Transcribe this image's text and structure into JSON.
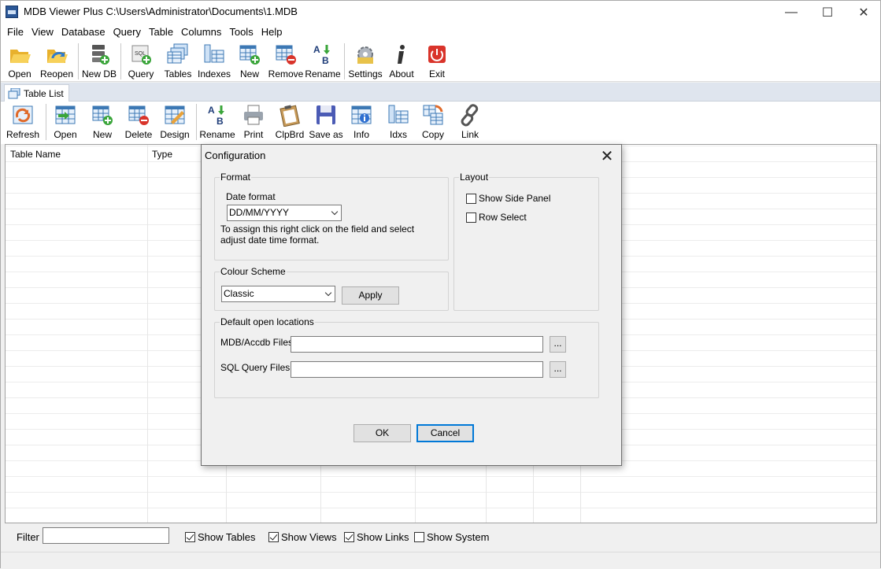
{
  "window": {
    "title": "MDB Viewer Plus C:\\Users\\Administrator\\Documents\\1.MDB",
    "minimize": "—",
    "maximize": "☐",
    "close": "✕"
  },
  "menu": [
    "File",
    "View",
    "Database",
    "Query",
    "Table",
    "Columns",
    "Tools",
    "Help"
  ],
  "toolbar_main": [
    {
      "label": "Open",
      "icon": "folder-open-icon"
    },
    {
      "label": "Reopen",
      "icon": "folder-reopen-icon"
    },
    {
      "label": "New DB",
      "icon": "new-database-icon"
    },
    {
      "label": "Query",
      "icon": "sql-query-icon"
    },
    {
      "label": "Tables",
      "icon": "tables-icon"
    },
    {
      "label": "Indexes",
      "icon": "indexes-icon"
    },
    {
      "label": "New",
      "icon": "new-table-icon"
    },
    {
      "label": "Remove",
      "icon": "remove-table-icon"
    },
    {
      "label": "Rename",
      "icon": "rename-icon"
    },
    {
      "label": "Settings",
      "icon": "settings-icon"
    },
    {
      "label": "About",
      "icon": "info-icon"
    },
    {
      "label": "Exit",
      "icon": "power-icon"
    }
  ],
  "tab": {
    "label": "Table List"
  },
  "toolbar_table": [
    {
      "label": "Refresh",
      "icon": "refresh-icon"
    },
    {
      "label": "Open",
      "icon": "open-table-icon"
    },
    {
      "label": "New",
      "icon": "new-table-icon"
    },
    {
      "label": "Delete",
      "icon": "delete-table-icon"
    },
    {
      "label": "Design",
      "icon": "design-icon"
    },
    {
      "label": "Rename",
      "icon": "rename-icon"
    },
    {
      "label": "Print",
      "icon": "printer-icon"
    },
    {
      "label": "ClpBrd",
      "icon": "clipboard-icon"
    },
    {
      "label": "Save as",
      "icon": "floppy-disk-icon"
    },
    {
      "label": "Info",
      "icon": "table-info-icon"
    },
    {
      "label": "Idxs",
      "icon": "indexes-icon"
    },
    {
      "label": "Copy",
      "icon": "copy-table-icon"
    },
    {
      "label": "Link",
      "icon": "link-icon"
    }
  ],
  "grid": {
    "columns": [
      "Table Name",
      "Type"
    ]
  },
  "filter": {
    "label": "Filter",
    "value": "",
    "checks": [
      {
        "label": "Show Tables",
        "checked": true
      },
      {
        "label": "Show Views",
        "checked": true
      },
      {
        "label": "Show Links",
        "checked": true
      },
      {
        "label": "Show System",
        "checked": false
      }
    ]
  },
  "dialog": {
    "title": "Configuration",
    "close": "✕",
    "format": {
      "group_label": "Format",
      "date_label": "Date format",
      "date_value": "DD/MM/YYYY",
      "hint": "To assign this right click on the field and select adjust date time format."
    },
    "layout": {
      "group_label": "Layout",
      "show_side_panel": "Show Side Panel",
      "row_select": "Row Select"
    },
    "colour": {
      "group_label": "Colour Scheme",
      "value": "Classic",
      "apply": "Apply"
    },
    "locations": {
      "group_label": "Default open locations",
      "mdb_label": "MDB/Accdb Files",
      "mdb_value": "",
      "sql_label": "SQL Query Files",
      "sql_value": "",
      "browse": "..."
    },
    "ok": "OK",
    "cancel": "Cancel"
  }
}
